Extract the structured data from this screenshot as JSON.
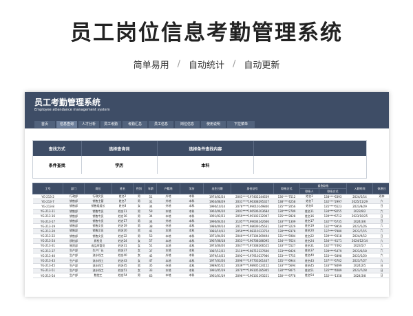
{
  "hero": {
    "title": "员工岗位信息考勤管理系统",
    "features": [
      "简单易用",
      "自动统计",
      "自动更新"
    ]
  },
  "app": {
    "title": "员工考勤管理系统",
    "subtitle": "Employee attendance management system",
    "tabs": [
      "首页",
      "信息查询",
      "人才分析",
      "员工考勤",
      "考勤汇总",
      "员工信息",
      "岗位信息",
      "使用说明",
      "下拉菜单"
    ],
    "active_tab": 1
  },
  "query": {
    "headers": [
      "查找方式",
      "选择查询词",
      "选择条件查找内容"
    ],
    "values": [
      "条件查找",
      "学历",
      "本科"
    ]
  },
  "table": {
    "headers": [
      "工号",
      "部门",
      "岗位",
      "姓名",
      "性别",
      "年龄",
      "户籍地",
      "学历",
      "出生日期",
      "身份证号",
      "联系方式",
      "紧急联系人",
      "紧急联系方式",
      "入职时间",
      "休息日"
    ],
    "group_header": "紧急联系",
    "sub_headers": [
      "联系人",
      "联系方式"
    ],
    "rows": [
      [
        "YG-213-2",
        "行政部",
        "行政文员",
        "姓名2",
        "男",
        "51",
        "外地",
        "本科",
        "1974/02/24",
        "2063****197402244639",
        "136****7512",
        "姓名2",
        "138****6393",
        "2024/5/14",
        "双休"
      ],
      [
        "YG-213-7",
        "销售部",
        "销售主管",
        "姓名7",
        "男",
        "31",
        "外地",
        "本科",
        "1963/08/29",
        "2031****196308295327",
        "138****4258",
        "姓名7",
        "132****2997",
        "2025/11/29",
        "六"
      ],
      [
        "YG-213-8",
        "销售部",
        "销售组组长",
        "姓名8",
        "女",
        "34",
        "外地",
        "本科",
        "1990/10/14",
        "2076****199010149840",
        "135****2056",
        "姓名8",
        "135****6523",
        "2023/8/29",
        "日"
      ],
      [
        "YG-213-11",
        "销售部",
        "销售专员",
        "姓名11",
        "男",
        "59",
        "本地",
        "本科",
        "1965/06/10",
        "2001****196506103684",
        "130****2789",
        "姓名11",
        "134****8255",
        "2023/9/2",
        "六"
      ],
      [
        "YG-213-16",
        "销售部",
        "销售专员",
        "姓名16",
        "男",
        "34",
        "本地",
        "本科",
        "1991/02/23",
        "2059****199102232907",
        "135****2828",
        "姓名16",
        "139****6712",
        "2023/10/25",
        "日"
      ],
      [
        "YG-213-17",
        "销售部",
        "销售专员",
        "姓名17",
        "男",
        "34",
        "外地",
        "本科",
        "1990/04/24",
        "2105****199004242666",
        "133****1309",
        "姓名17",
        "132****6735",
        "2024/3/6",
        "日"
      ],
      [
        "YG-213-19",
        "销售部",
        "销售文员",
        "姓名19",
        "男",
        "38",
        "外地",
        "本科",
        "1986/09/14",
        "2011****198609145631",
        "134****3229",
        "姓名19",
        "132****9959",
        "2023/5/26",
        "六"
      ],
      [
        "YG-213-20",
        "销售部",
        "销售文员",
        "姓名20",
        "男",
        "41",
        "本地",
        "本科",
        "1983/10/12",
        "2059****198310123754",
        "130****8378",
        "姓名20",
        "137****7980",
        "2023/7/15",
        "六"
      ],
      [
        "YG-213-22",
        "销售部",
        "销售文员",
        "姓名22",
        "男",
        "53",
        "本地",
        "本科",
        "1971/04/26",
        "2040****197104269494",
        "131****5984",
        "姓名22",
        "139****9318",
        "2024/9/12",
        "日"
      ],
      [
        "YG-213-24",
        "质检部",
        "质检员",
        "姓名24",
        "女",
        "57",
        "本地",
        "本科",
        "1967/08/18",
        "2053****196708186095",
        "134****7624",
        "姓名24",
        "134****4171",
        "2024/12/14",
        "六"
      ],
      [
        "YG-213-31",
        "物资部",
        "成品库管员",
        "姓名31",
        "女",
        "51",
        "本地",
        "本科",
        "1973/06/20",
        "2047****197308266525",
        "133****5527",
        "姓名31",
        "132****7492",
        "2023/5/7",
        "六"
      ],
      [
        "YG-213-37",
        "生产部",
        "生产厂长",
        "姓名37",
        "女",
        "37",
        "本地",
        "本科",
        "1987/12/22",
        "2110****198712227600",
        "133****8426",
        "姓名37",
        "139****5479",
        "2023/6/18",
        "六"
      ],
      [
        "YG-213-40",
        "生产部",
        "流水线工",
        "姓名40",
        "女",
        "45",
        "外地",
        "本科",
        "1979/10/23",
        "2092****197910237980",
        "133****7755",
        "姓名40",
        "133****5898",
        "2023/5/20",
        "六"
      ],
      [
        "YG-213-43",
        "生产部",
        "流水线工",
        "姓名43",
        "女",
        "47",
        "本地",
        "本科",
        "1977/03/26",
        "2096****197703261447",
        "135****6944",
        "姓名43",
        "137****6702",
        "2023/7/27",
        "六"
      ],
      [
        "YG-213-45",
        "生产部",
        "流水线工",
        "姓名45",
        "男",
        "35",
        "外地",
        "本科",
        "1989/05/12",
        "2039****198905124152",
        "133****5694",
        "姓名45",
        "133****8499",
        "2024/2/5",
        "日"
      ],
      [
        "YG-213-51",
        "生产部",
        "流水线工",
        "姓名51",
        "女",
        "33",
        "本地",
        "本科",
        "1991/05/19",
        "2070****199105285905",
        "130****9075",
        "姓名51",
        "135****4089",
        "2023/7/28",
        "日"
      ],
      [
        "YG-213-54",
        "生产部",
        "数控工",
        "姓名54",
        "男",
        "63",
        "本地",
        "本科",
        "1961/01/19",
        "2096****196101193221",
        "130****9778",
        "姓名54",
        "132****1358",
        "2024/3/8",
        "日"
      ]
    ]
  },
  "colors": {
    "header_bg": "#3e4d66",
    "tab_bg": "#51627c",
    "row_alt": "#eef0f3"
  }
}
